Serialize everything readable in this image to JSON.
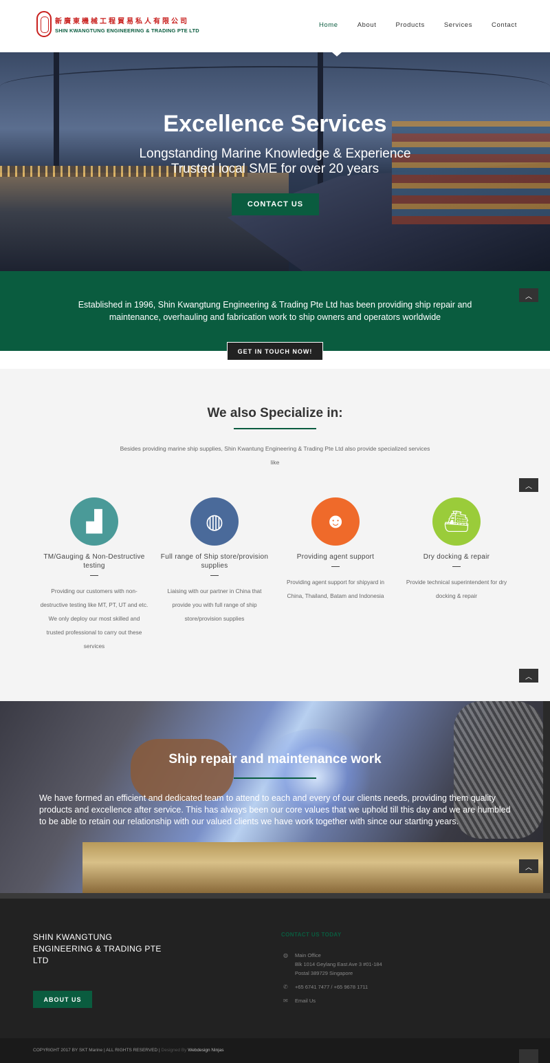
{
  "header": {
    "logo_cn": "新廣東機械工程貿易私人有限公司",
    "logo_en": "SHIN KWANGTUNG ENGINEERING & TRADING PTE LTD",
    "nav": [
      "Home",
      "About",
      "Products",
      "Services",
      "Contact"
    ],
    "active_nav": "Home"
  },
  "hero": {
    "title": "Excellence Services",
    "subtitle_1": "Longstanding Marine Knowledge & Experience",
    "subtitle_2": "Trusted local SME for over 20 years",
    "button": "CONTACT US"
  },
  "intro": {
    "text": "Established in 1996, Shin Kwangtung Engineering & Trading Pte Ltd has been providing ship repair and maintenance, overhauling and fabrication work to ship owners and operators worldwide",
    "button": "GET IN TOUCH NOW!"
  },
  "specialize": {
    "title": "We also Specialize in:",
    "description": "Besides providing marine ship supplies, Shin Kwantung Engineering & Trading Pte Ltd also provide specialized services like",
    "services": [
      {
        "title": "TM/Gauging & Non-Destructive testing",
        "text": "Providing our customers with non-destructive testing like MT, PT, UT and etc. We only deploy our most skilled and trusted professional to carry out these services",
        "color": "#4a9a98",
        "icon": "factory-icon",
        "glyph": "▟"
      },
      {
        "title": "Full range of Ship store/provision supplies",
        "text": "Liaising with our partner in China that provide you with full range of ship store/provision supplies",
        "color": "#4a6a9a",
        "icon": "globe-icon",
        "glyph": "◍"
      },
      {
        "title": "Providing agent support",
        "text": "Providing agent support for shipyard in China, Thailand, Batam and Indonesia",
        "color": "#ef6a2a",
        "icon": "group-icon",
        "glyph": "☻"
      },
      {
        "title": "Dry docking & repair",
        "text": "Provide technical superintendent for dry docking & repair",
        "color": "#9acc3a",
        "icon": "ship-icon",
        "glyph": "⛴"
      }
    ]
  },
  "repair": {
    "title": "Ship repair and maintenance work",
    "text": "We have formed an efficient and dedicated team to attend to each and every of our clients needs, providing them quality products and excellence after service. This has always been our core values that we uphold till this day and we are humbled to be able to retain our relationship with our valued clients we have work together with since our starting years."
  },
  "footer": {
    "company": "SHIN KWANGTUNG ENGINEERING & TRADING PTE LTD",
    "button": "ABOUT US",
    "contact_title": "CONTACT US TODAY",
    "office_label": "Main Office",
    "office_line1": "Blk 1014 Geylang East Ave 3 #01-184",
    "office_line2": "Postal 389729 Singapore",
    "phone": "+65 6741 7477 / +65 9678 1711",
    "email": "Email Us",
    "copyright": "COPYRIGHT 2017 BY SKT Marine | ALL RIGHTS RESERVED |",
    "designed_by": "Designed By",
    "designer": "Webdesign Ninjas"
  },
  "colors": {
    "brand_green": "#0a5c3f",
    "dark": "#222222",
    "to_top": "#333333"
  }
}
